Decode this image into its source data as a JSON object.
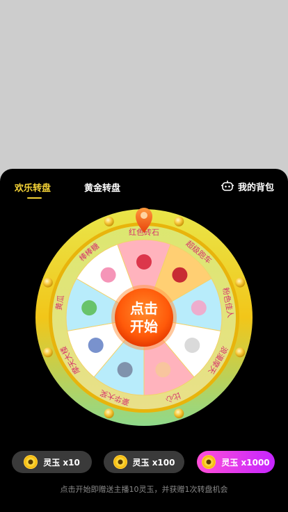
{
  "tabs": [
    {
      "label": "欢乐转盘",
      "active": true
    },
    {
      "label": "黄金转盘",
      "active": false
    }
  ],
  "backpack": {
    "label": "我的背包",
    "icon": "robot-icon"
  },
  "wheel": {
    "center_line1": "点击",
    "center_line2": "开始",
    "pointer_icon": "pointer-pin-icon",
    "prizes": [
      {
        "name": "红色砖石",
        "icon": "red-gem-icon",
        "color": "#ffb3bd"
      },
      {
        "name": "超级跑车",
        "icon": "sports-car-icon",
        "color": "#ffcf73"
      },
      {
        "name": "粉色佳人",
        "icon": "pink-perfume-icon",
        "color": "#b8ecfb"
      },
      {
        "name": "浪漫摩天",
        "icon": "moon-icon",
        "color": "#ffffff"
      },
      {
        "name": "比心",
        "icon": "heart-hand-icon",
        "color": "#ffb3bd"
      },
      {
        "name": "豪华大奖",
        "icon": "luxury-car-icon",
        "color": "#b8ecfb"
      },
      {
        "name": "摩天大楼",
        "icon": "sneaker-icon",
        "color": "#ffffff"
      },
      {
        "name": "黄瓜",
        "icon": "cucumber-icon",
        "color": "#b8ecfb"
      },
      {
        "name": "棒棒糖",
        "icon": "lollipop-icon",
        "color": "#ffffff"
      }
    ]
  },
  "buttons": [
    {
      "label": "灵玉 x10",
      "icon": "coin-icon"
    },
    {
      "label": "灵玉 x100",
      "icon": "coin-icon"
    },
    {
      "label": "灵玉 x1000",
      "icon": "coin-icon"
    }
  ],
  "hint": "点击开始即赠送主播10灵玉，并获赠1次转盘机会",
  "colors": {
    "accent": "#f6d437",
    "highlight": "#d63bff"
  }
}
